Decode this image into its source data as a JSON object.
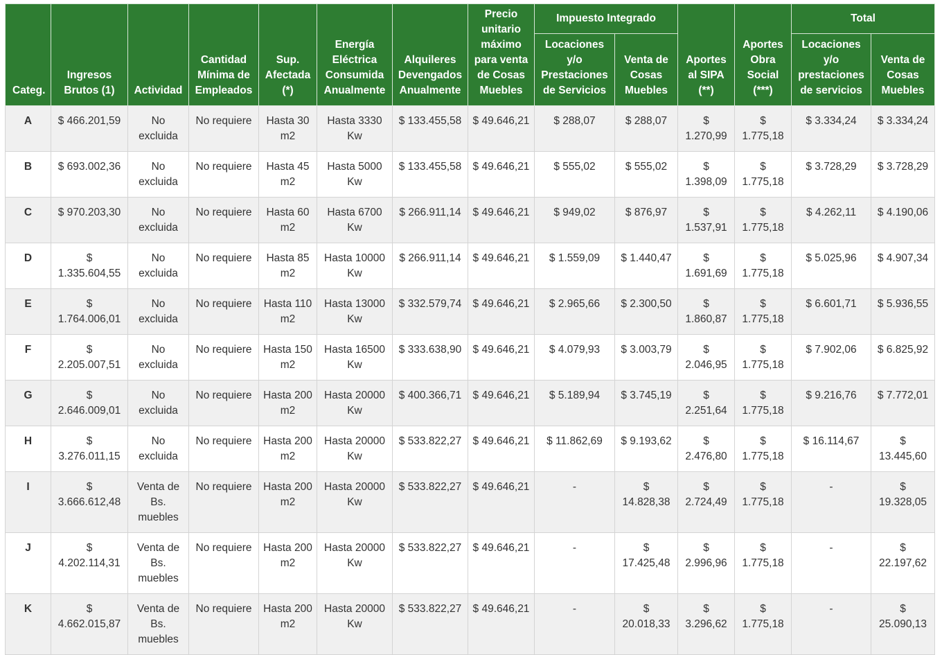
{
  "headers": {
    "categ": "Categ.",
    "ingresos": "Ingresos Brutos (1)",
    "actividad": "Actividad",
    "empleados": "Cantidad Mínima de Empleados",
    "superficie": "Sup. Afectada (*)",
    "energia": "Energía Eléctrica Consumida Anualmente",
    "alquileres": "Alquileres Devengados Anualmente",
    "precio": "Precio unitario máximo para venta de Cosas Muebles",
    "impuesto_group": "Impuesto Integrado",
    "impuesto_locaciones": "Locaciones y/o Prestaciones de Servicios",
    "impuesto_venta": "Venta de Cosas Muebles",
    "sipa": "Aportes al SIPA (**)",
    "obra_social": "Aportes Obra Social (***)",
    "total_group": "Total",
    "total_locaciones": "Locaciones y/o prestaciones de servicios",
    "total_venta": "Venta de Cosas Muebles"
  },
  "rows": [
    {
      "cat": "A",
      "ingresos": "$ 466.201,59",
      "actividad": "No excluida",
      "empleados": "No requiere",
      "superficie": "Hasta 30 m2",
      "energia": "Hasta 3330 Kw",
      "alquileres": "$ 133.455,58",
      "precio": "$ 49.646,21",
      "imp_loc": "$ 288,07",
      "imp_venta": "$ 288,07",
      "sipa": "$ 1.270,99",
      "obra": "$ 1.775,18",
      "tot_loc": "$ 3.334,24",
      "tot_venta": "$ 3.334,24"
    },
    {
      "cat": "B",
      "ingresos": "$ 693.002,36",
      "actividad": "No excluida",
      "empleados": "No requiere",
      "superficie": "Hasta 45 m2",
      "energia": "Hasta 5000 Kw",
      "alquileres": "$ 133.455,58",
      "precio": "$ 49.646,21",
      "imp_loc": "$ 555,02",
      "imp_venta": "$ 555,02",
      "sipa": "$ 1.398,09",
      "obra": "$ 1.775,18",
      "tot_loc": "$ 3.728,29",
      "tot_venta": "$ 3.728,29"
    },
    {
      "cat": "C",
      "ingresos": "$ 970.203,30",
      "actividad": "No excluida",
      "empleados": "No requiere",
      "superficie": "Hasta 60 m2",
      "energia": "Hasta 6700 Kw",
      "alquileres": "$ 266.911,14",
      "precio": "$ 49.646,21",
      "imp_loc": "$ 949,02",
      "imp_venta": "$ 876,97",
      "sipa": "$ 1.537,91",
      "obra": "$ 1.775,18",
      "tot_loc": "$ 4.262,11",
      "tot_venta": "$ 4.190,06"
    },
    {
      "cat": "D",
      "ingresos": "$ 1.335.604,55",
      "actividad": "No excluida",
      "empleados": "No requiere",
      "superficie": "Hasta 85 m2",
      "energia": "Hasta 10000 Kw",
      "alquileres": "$ 266.911,14",
      "precio": "$ 49.646,21",
      "imp_loc": "$ 1.559,09",
      "imp_venta": "$ 1.440,47",
      "sipa": "$ 1.691,69",
      "obra": "$ 1.775,18",
      "tot_loc": "$ 5.025,96",
      "tot_venta": "$ 4.907,34"
    },
    {
      "cat": "E",
      "ingresos": "$ 1.764.006,01",
      "actividad": "No excluida",
      "empleados": "No requiere",
      "superficie": "Hasta 110 m2",
      "energia": "Hasta 13000 Kw",
      "alquileres": "$ 332.579,74",
      "precio": "$ 49.646,21",
      "imp_loc": "$ 2.965,66",
      "imp_venta": "$ 2.300,50",
      "sipa": "$ 1.860,87",
      "obra": "$ 1.775,18",
      "tot_loc": "$ 6.601,71",
      "tot_venta": "$ 5.936,55"
    },
    {
      "cat": "F",
      "ingresos": "$ 2.205.007,51",
      "actividad": "No excluida",
      "empleados": "No requiere",
      "superficie": "Hasta 150 m2",
      "energia": "Hasta 16500 Kw",
      "alquileres": "$ 333.638,90",
      "precio": "$ 49.646,21",
      "imp_loc": "$ 4.079,93",
      "imp_venta": "$ 3.003,79",
      "sipa": "$ 2.046,95",
      "obra": "$ 1.775,18",
      "tot_loc": "$ 7.902,06",
      "tot_venta": "$ 6.825,92"
    },
    {
      "cat": "G",
      "ingresos": "$ 2.646.009,01",
      "actividad": "No excluida",
      "empleados": "No requiere",
      "superficie": "Hasta 200 m2",
      "energia": "Hasta 20000 Kw",
      "alquileres": "$ 400.366,71",
      "precio": "$ 49.646,21",
      "imp_loc": "$ 5.189,94",
      "imp_venta": "$ 3.745,19",
      "sipa": "$ 2.251,64",
      "obra": "$ 1.775,18",
      "tot_loc": "$ 9.216,76",
      "tot_venta": "$ 7.772,01"
    },
    {
      "cat": "H",
      "ingresos": "$ 3.276.011,15",
      "actividad": "No excluida",
      "empleados": "No requiere",
      "superficie": "Hasta 200 m2",
      "energia": "Hasta 20000 Kw",
      "alquileres": "$ 533.822,27",
      "precio": "$ 49.646,21",
      "imp_loc": "$ 11.862,69",
      "imp_venta": "$ 9.193,62",
      "sipa": "$ 2.476,80",
      "obra": "$ 1.775,18",
      "tot_loc": "$ 16.114,67",
      "tot_venta": "$ 13.445,60"
    },
    {
      "cat": "I",
      "ingresos": "$ 3.666.612,48",
      "actividad": "Venta de Bs. muebles",
      "empleados": "No requiere",
      "superficie": "Hasta 200 m2",
      "energia": "Hasta 20000 Kw",
      "alquileres": "$ 533.822,27",
      "precio": "$ 49.646,21",
      "imp_loc": "-",
      "imp_venta": "$ 14.828,38",
      "sipa": "$ 2.724,49",
      "obra": "$ 1.775,18",
      "tot_loc": "-",
      "tot_venta": "$ 19.328,05"
    },
    {
      "cat": "J",
      "ingresos": "$ 4.202.114,31",
      "actividad": "Venta de Bs. muebles",
      "empleados": "No requiere",
      "superficie": "Hasta 200 m2",
      "energia": "Hasta 20000 Kw",
      "alquileres": "$ 533.822,27",
      "precio": "$ 49.646,21",
      "imp_loc": "-",
      "imp_venta": "$ 17.425,48",
      "sipa": "$ 2.996,96",
      "obra": "$ 1.775,18",
      "tot_loc": "-",
      "tot_venta": "$ 22.197,62"
    },
    {
      "cat": "K",
      "ingresos": "$ 4.662.015,87",
      "actividad": "Venta de Bs. muebles",
      "empleados": "No requiere",
      "superficie": "Hasta 200 m2",
      "energia": "Hasta 20000 Kw",
      "alquileres": "$ 533.822,27",
      "precio": "$ 49.646,21",
      "imp_loc": "-",
      "imp_venta": "$ 20.018,33",
      "sipa": "$ 3.296,62",
      "obra": "$ 1.775,18",
      "tot_loc": "-",
      "tot_venta": "$ 25.090,13"
    }
  ]
}
